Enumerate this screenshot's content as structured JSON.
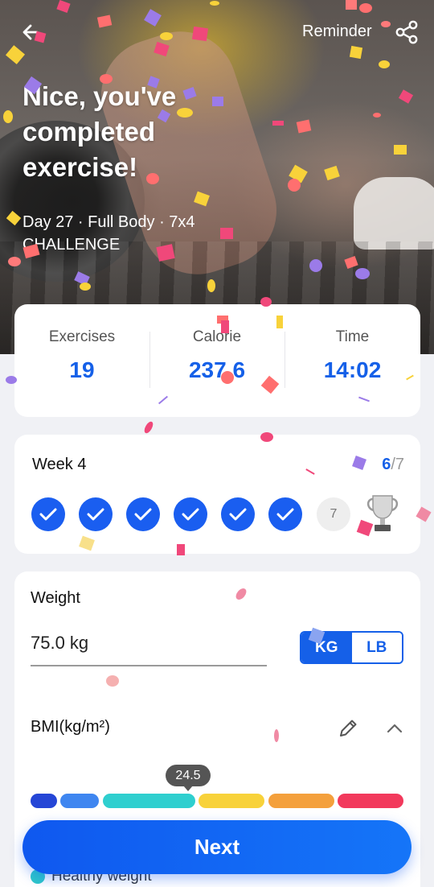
{
  "header": {
    "reminder_label": "Reminder",
    "title": "Nice, you've\ncompleted\nexercise!",
    "subtitle_line1": "Day 27 · Full Body · 7x4",
    "subtitle_line2": "CHALLENGE"
  },
  "stats": {
    "exercises_label": "Exercises",
    "exercises_value": "19",
    "calorie_label": "Calorie",
    "calorie_value": "237.6",
    "time_label": "Time",
    "time_value": "14:02"
  },
  "week": {
    "label": "Week 4",
    "completed": "6",
    "total": "/7",
    "pending_day": "7"
  },
  "weight": {
    "label": "Weight",
    "value": "75.0 kg",
    "unit_kg": "KG",
    "unit_lb": "LB"
  },
  "bmi": {
    "label": "BMI(kg/m²)",
    "value": "24.5",
    "colors": [
      "#2546d6",
      "#3f86f0",
      "#2fcfcf",
      "#f8d23a",
      "#f4a03c",
      "#f2395c"
    ],
    "legend_peek": "Healthy weight"
  },
  "footer": {
    "next_label": "Next"
  }
}
